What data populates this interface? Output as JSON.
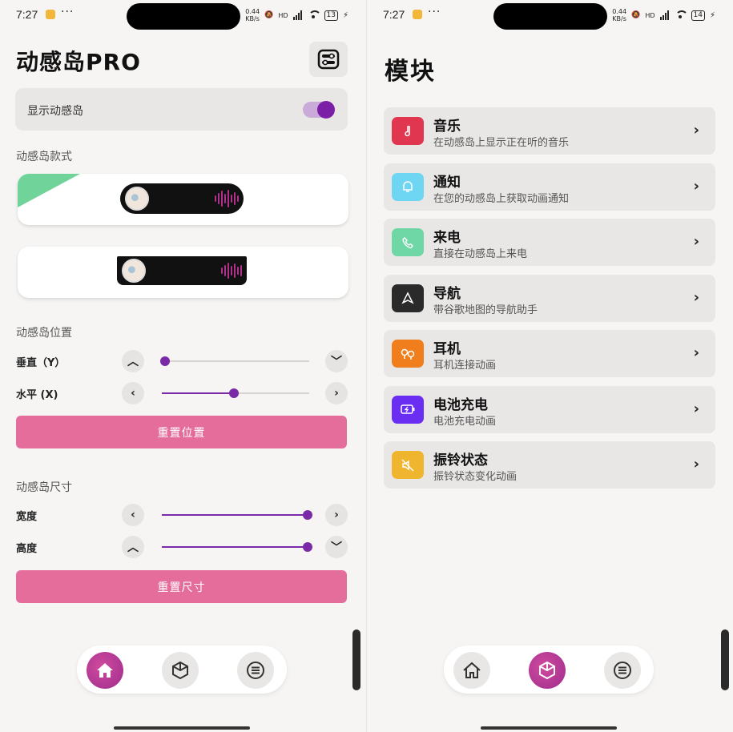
{
  "status_left": {
    "time": "7:27",
    "dots": "···",
    "speed": "0.44\nKB/s",
    "hd": "HD",
    "battery": "13"
  },
  "status_right": {
    "time": "7:27",
    "dots": "···",
    "speed": "0.44\nKB/s",
    "hd": "HD",
    "battery": "14"
  },
  "home": {
    "title": "动感岛PRO",
    "show_island_label": "显示动感岛",
    "show_island_on": true,
    "style_section": "动感岛款式",
    "position_section": "动感岛位置",
    "vertical_label": "垂直（Y）",
    "horizontal_label": "水平 (X)",
    "vertical_value": 0.02,
    "horizontal_value": 0.49,
    "reset_position": "重置位置",
    "size_section": "动感岛尺寸",
    "width_label": "宽度",
    "height_label": "高度",
    "width_value": 0.99,
    "height_value": 0.99,
    "reset_size": "重置尺寸",
    "accent_color": "#7b2aa7",
    "button_color": "#e56d9c"
  },
  "modules": {
    "title": "模块",
    "items": [
      {
        "title": "音乐",
        "subtitle": "在动感岛上显示正在听的音乐",
        "color": "#e0364f",
        "icon": "music-note-icon"
      },
      {
        "title": "通知",
        "subtitle": "在您的动感岛上获取动画通知",
        "color": "#6ed6f2",
        "icon": "bell-icon"
      },
      {
        "title": "来电",
        "subtitle": "直接在动感岛上来电",
        "color": "#6fd6a6",
        "icon": "phone-icon"
      },
      {
        "title": "导航",
        "subtitle": "带谷歌地图的导航助手",
        "color": "#2a2a2a",
        "icon": "navigation-arrow-icon"
      },
      {
        "title": "耳机",
        "subtitle": "耳机连接动画",
        "color": "#f07e1d",
        "icon": "earbuds-icon"
      },
      {
        "title": "电池充电",
        "subtitle": "电池充电动画",
        "color": "#6a2df2",
        "icon": "battery-charging-icon"
      },
      {
        "title": "振铃状态",
        "subtitle": "振铃状态变化动画",
        "color": "#f0b52e",
        "icon": "mute-icon"
      }
    ]
  },
  "nav": [
    "home-icon",
    "cube-icon",
    "menu-icon"
  ]
}
